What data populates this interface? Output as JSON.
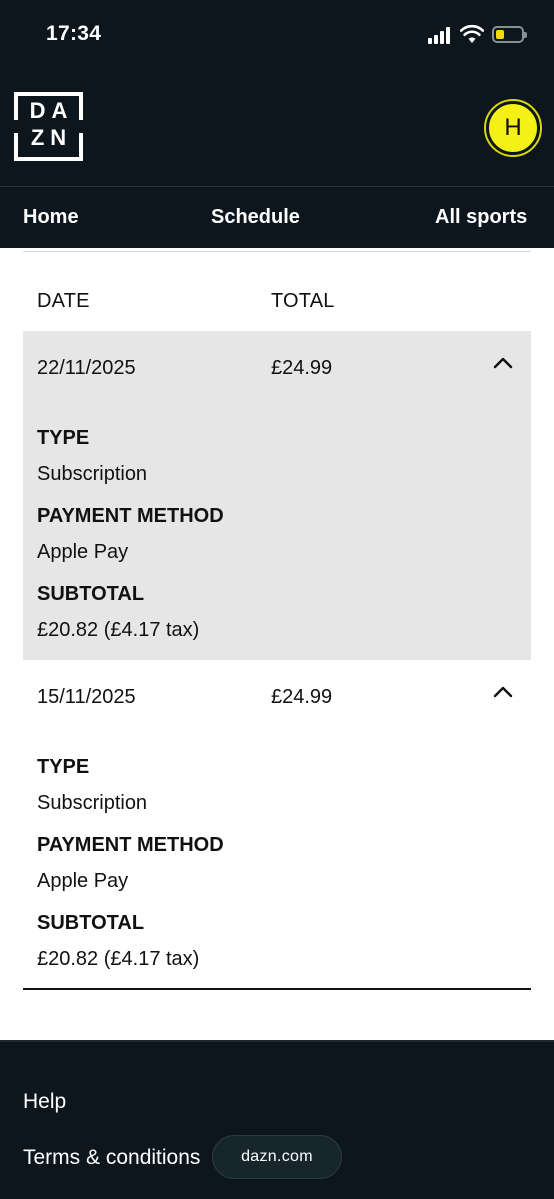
{
  "status_bar": {
    "time": "17:34"
  },
  "header": {
    "logo_top": "DA",
    "logo_bottom": "ZN",
    "avatar_initial": "H"
  },
  "nav": {
    "items": [
      "Home",
      "Schedule",
      "All sports"
    ]
  },
  "table": {
    "columns": [
      "DATE",
      "TOTAL"
    ]
  },
  "transactions": [
    {
      "date": "22/11/2025",
      "total": "£24.99",
      "type_label": "TYPE",
      "type": "Subscription",
      "payment_label": "PAYMENT METHOD",
      "payment": "Apple Pay",
      "subtotal_label": "SUBTOTAL",
      "subtotal": "£20.82 (£4.17 tax)"
    },
    {
      "date": "15/11/2025",
      "total": "£24.99",
      "type_label": "TYPE",
      "type": "Subscription",
      "payment_label": "PAYMENT METHOD",
      "payment": "Apple Pay",
      "subtotal_label": "SUBTOTAL",
      "subtotal": "£20.82 (£4.17 tax)"
    }
  ],
  "footer": {
    "help": "Help",
    "terms": "Terms & conditions",
    "site": "dazn.com"
  },
  "colors": {
    "dark_bg": "#0c161c",
    "expanded_row": "#e6e6e6",
    "avatar": "#f5f116"
  }
}
